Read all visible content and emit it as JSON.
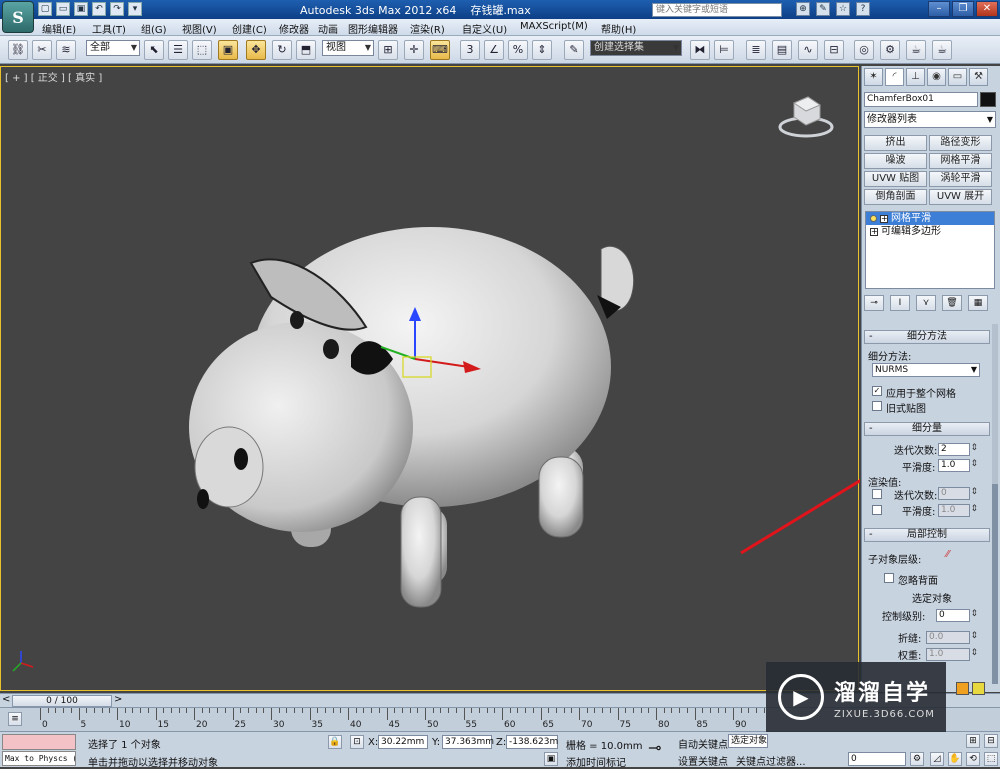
{
  "titlebar": {
    "app_button": "S",
    "title": "Autodesk 3ds Max  2012 x64",
    "file": "存钱罐.max",
    "search_placeholder": "键入关键字或短语"
  },
  "menu": [
    "编辑(E)",
    "工具(T)",
    "组(G)",
    "视图(V)",
    "创建(C)",
    "修改器",
    "动画",
    "图形编辑器",
    "渲染(R)",
    "自定义(U)",
    "MAXScript(M)",
    "帮助(H)"
  ],
  "toolbar": {
    "selection_filter": "全部",
    "ref_coord": "视图",
    "named_selection": "创建选择集"
  },
  "viewport": {
    "label": "[ + ] [ 正交 ] [ 真实 ]"
  },
  "command_panel": {
    "object_name": "ChamferBox01",
    "modifier_list": "修改器列表",
    "modifier_buttons": [
      "挤出",
      "路径变形",
      "噪波",
      "网格平滑",
      "UVW 贴图",
      "涡轮平滑",
      "倒角剖面",
      "UVW 展开"
    ],
    "stack": [
      "网格平滑",
      "可编辑多边形"
    ],
    "subdivision_method": {
      "title": "细分方法",
      "label": "细分方法:",
      "value": "NURMS",
      "apply_whole_mesh": "应用于整个网格",
      "old_style_mapping": "旧式贴图"
    },
    "subdivision_amount": {
      "title": "细分量",
      "iterations_label": "迭代次数:",
      "iterations": "2",
      "smoothness_label": "平滑度:",
      "smoothness": "1.0",
      "render_values": "渲染值:",
      "render_iterations_label": "迭代次数:",
      "render_iterations": "0",
      "render_smoothness_label": "平滑度:",
      "render_smoothness": "1.0"
    },
    "local_control": {
      "title": "局部控制",
      "subobject_level": "子对象层级:",
      "ignore_backfacing": "忽略背面",
      "select_object": "选定对象",
      "control_level_label": "控制级别:",
      "control_level": "0",
      "crease_label": "折缝:",
      "crease": "0.0",
      "weight_label": "权重:",
      "weight": "1.0"
    }
  },
  "timeline": {
    "frame_display": "0 / 100",
    "ticks": [
      "0",
      "5",
      "10",
      "15",
      "20",
      "25",
      "30",
      "35",
      "40",
      "45",
      "50",
      "55",
      "60",
      "65",
      "70",
      "75",
      "80",
      "85",
      "90"
    ]
  },
  "status": {
    "listener": "Max to Physcs (",
    "selected": "选择了 1 个对象",
    "prompt": "单击并拖动以选择并移动对象",
    "x_label": "X:",
    "x": "30.22mm",
    "y_label": "Y:",
    "y": "37.363mm",
    "z_label": "Z:",
    "z": "-138.623m",
    "grid": "栅格 = 10.0mm",
    "add_time_tag": "添加时间标记",
    "auto_key": "自动关键点",
    "set_key": "设置关键点",
    "selected_obj": "选定对象",
    "key_filters": "关键点过滤器...",
    "frame": "0"
  },
  "watermark": {
    "title": "溜溜自学",
    "subtitle": "ZIXUE.3D66.COM"
  },
  "colors": {
    "viewport_bg": "#444444",
    "active_border": "#e6c12c",
    "annotation": "#e0141a",
    "swatch_orange": "#f0a020",
    "swatch_yellow": "#e8d840"
  }
}
